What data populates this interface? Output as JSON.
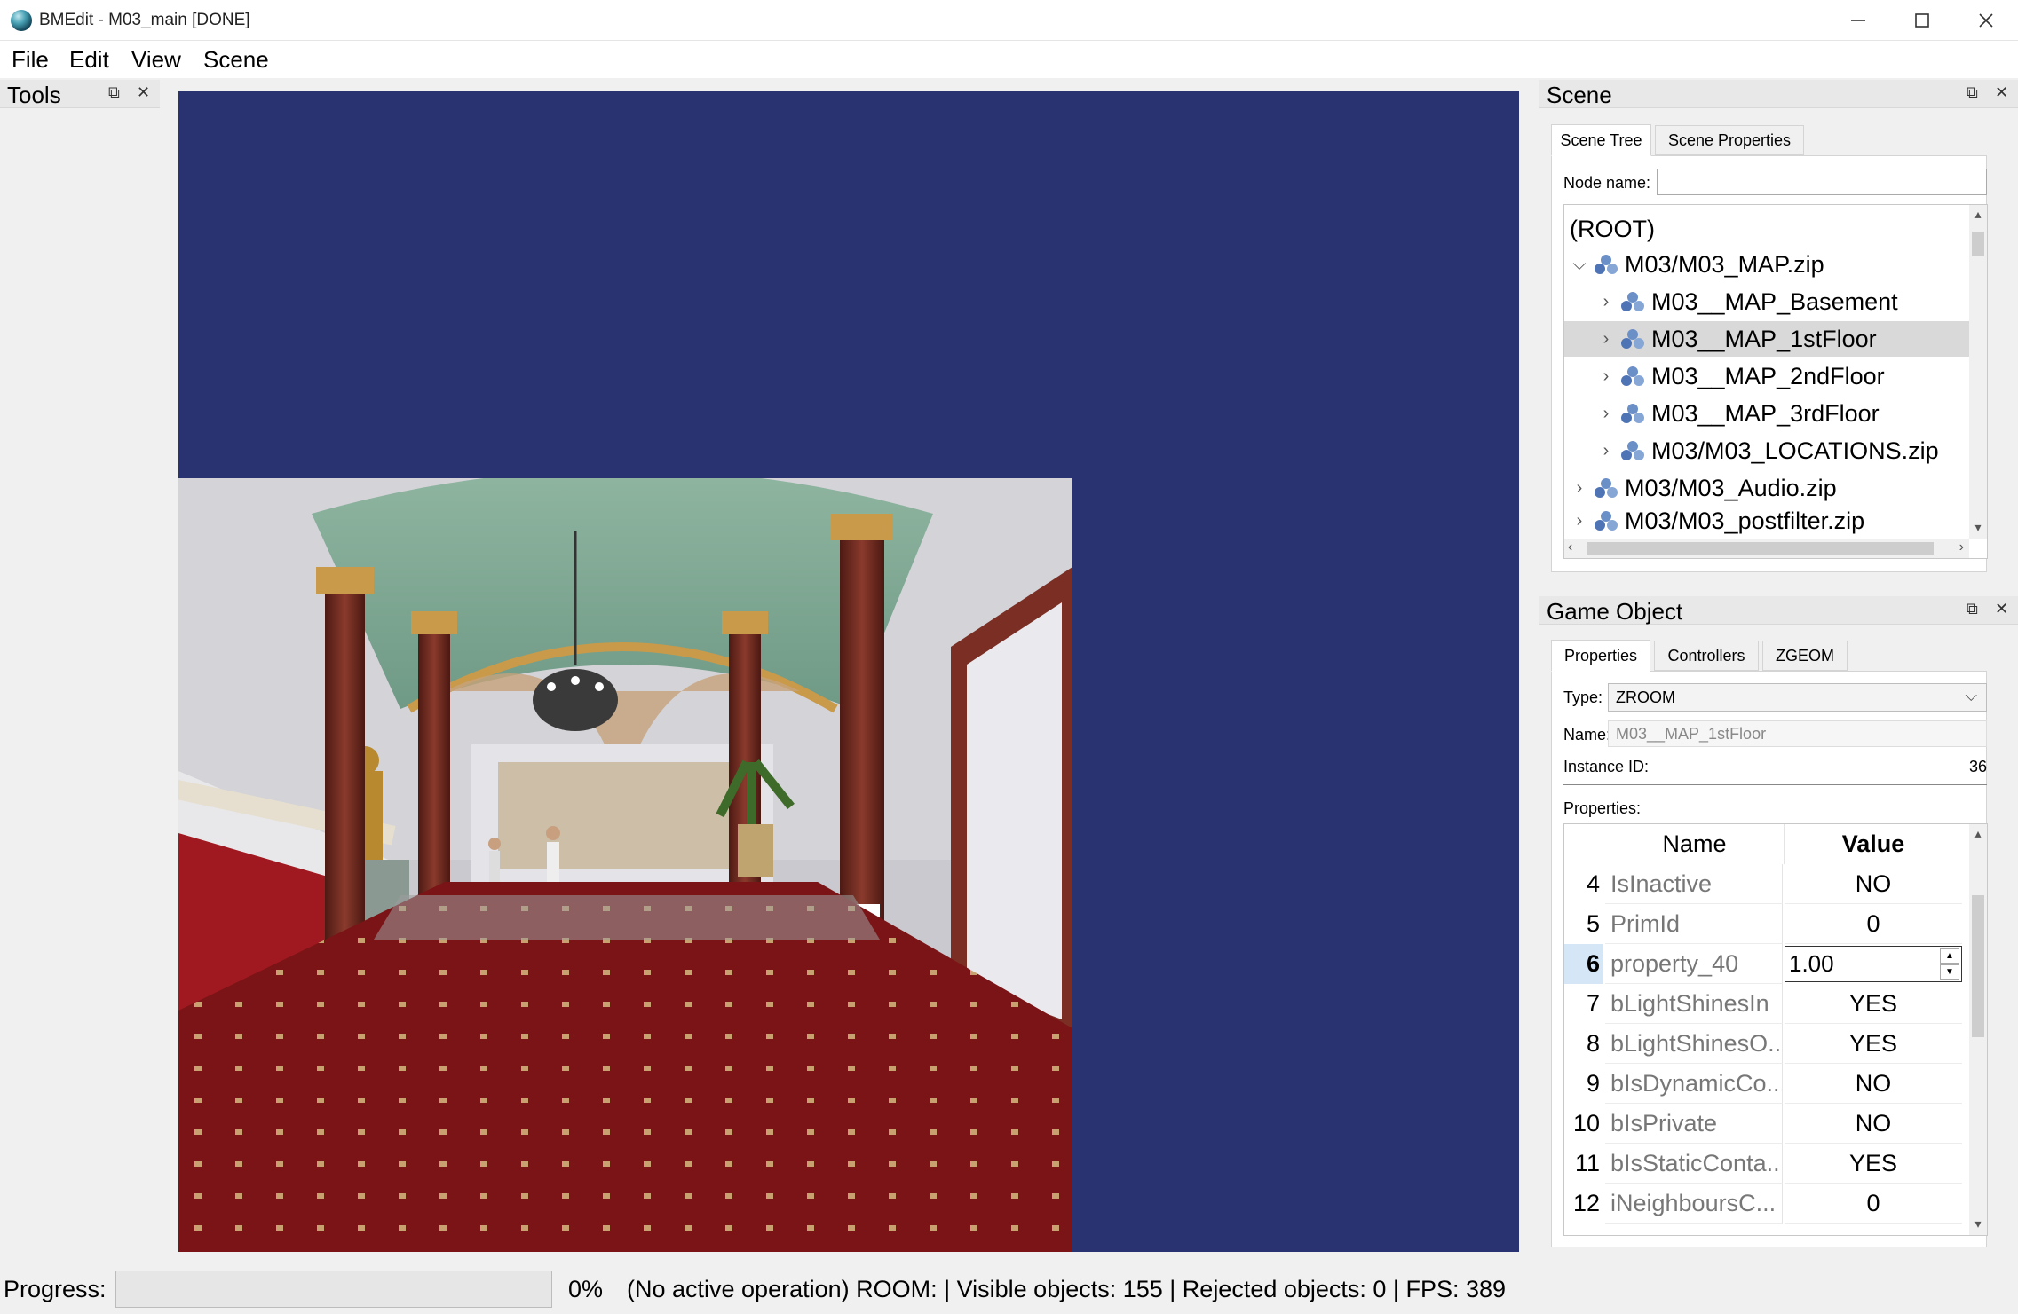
{
  "window": {
    "title": "BMEdit - M03_main [DONE]"
  },
  "menu": [
    "File",
    "Edit",
    "View",
    "Scene"
  ],
  "tools_panel": {
    "title": "Tools"
  },
  "scene_panel": {
    "title": "Scene",
    "tabs": [
      "Scene Tree",
      "Scene Properties"
    ],
    "node_name_label": "Node name:",
    "node_name_value": "",
    "tree": [
      {
        "label": "(ROOT)",
        "level": 0,
        "expander": "none",
        "icon": false
      },
      {
        "label": "M03/M03_MAP.zip",
        "level": 1,
        "expander": "expanded",
        "icon": true
      },
      {
        "label": "M03__MAP_Basement",
        "level": 2,
        "expander": "collapsed",
        "icon": true
      },
      {
        "label": "M03__MAP_1stFloor",
        "level": 2,
        "expander": "collapsed",
        "icon": true,
        "selected": true
      },
      {
        "label": "M03__MAP_2ndFloor",
        "level": 2,
        "expander": "collapsed",
        "icon": true
      },
      {
        "label": "M03__MAP_3rdFloor",
        "level": 2,
        "expander": "collapsed",
        "icon": true
      },
      {
        "label": "M03/M03_LOCATIONS.zip",
        "level": 2,
        "expander": "collapsed",
        "icon": true
      },
      {
        "label": "M03/M03_Audio.zip",
        "level": 1,
        "expander": "collapsed",
        "icon": true
      },
      {
        "label": "M03/M03_postfilter.zip",
        "level": 1,
        "expander": "collapsed",
        "icon": true
      }
    ]
  },
  "game_object_panel": {
    "title": "Game Object",
    "tabs": [
      "Properties",
      "Controllers",
      "ZGEOM"
    ],
    "type_label": "Type:",
    "type_value": "ZROOM",
    "name_label": "Name:",
    "name_value": "M03__MAP_1stFloor",
    "instance_id_label": "Instance ID:",
    "instance_id_value": "36",
    "properties_label": "Properties:",
    "columns": [
      "Name",
      "Value"
    ],
    "rows": [
      {
        "num": "4",
        "name": "IsInactive",
        "value": "NO"
      },
      {
        "num": "5",
        "name": "PrimId",
        "value": "0"
      },
      {
        "num": "6",
        "name": "property_40",
        "value": "1.00",
        "editing": true
      },
      {
        "num": "7",
        "name": "bLightShinesIn",
        "value": "YES"
      },
      {
        "num": "8",
        "name": "bLightShinesO...",
        "value": "YES"
      },
      {
        "num": "9",
        "name": "bIsDynamicCo...",
        "value": "NO"
      },
      {
        "num": "10",
        "name": "bIsPrivate",
        "value": "NO"
      },
      {
        "num": "11",
        "name": "bIsStaticConta...",
        "value": "YES"
      },
      {
        "num": "12",
        "name": "iNeighboursC...",
        "value": "0"
      }
    ]
  },
  "status": {
    "progress_label": "Progress:",
    "progress_value": 0,
    "progress_text": "0%",
    "message": "(No active operation) ROOM:  | Visible objects: 155 | Rejected objects: 0 | FPS: 389"
  },
  "colors": {
    "viewport_bg": "#293372",
    "carpet": "#7a1416",
    "ceiling": "#7fa58f",
    "column": "#6e2a22",
    "gold": "#c99a4a"
  }
}
